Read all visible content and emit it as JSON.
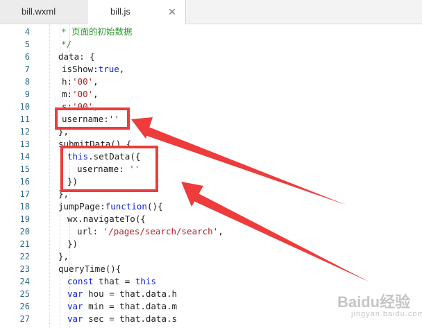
{
  "tabs": [
    {
      "label": "bill.wxml",
      "active": false
    },
    {
      "label": "bill.js",
      "active": true,
      "close_glyph": "✕"
    }
  ],
  "line_numbers": [
    "4",
    "5",
    "6",
    "7",
    "8",
    "9",
    "10",
    "11",
    "12",
    "13",
    "14",
    "15",
    "16",
    "17",
    "18",
    "19",
    "20",
    "21",
    "22",
    "23",
    "24",
    "25",
    "26",
    "27"
  ],
  "code": {
    "l4": "* 页面的初始数据",
    "l5": "*/",
    "l6": "data: {",
    "l7a": "isShow:",
    "l7b": "true",
    "l7c": ",",
    "l8a": "h:",
    "l8b": "'00'",
    "l8c": ",",
    "l9a": "m:",
    "l9b": "'00'",
    "l9c": ",",
    "l10a": "s:",
    "l10b": "'00'",
    "l10c": ",",
    "l11a": "username:",
    "l11b": "''",
    "l12": "},",
    "l13": "submitData() {",
    "l14a": "this",
    "l14b": ".setData({",
    "l15a": "username: ",
    "l15b": "''",
    "l16": "})",
    "l17": "},",
    "l18a": "jumpPage:",
    "l18b": "function",
    "l18c": "(){",
    "l19": "wx.navigateTo({",
    "l20a": "url: ",
    "l20b": "'/pages/search/search'",
    "l20c": ",",
    "l21": "})",
    "l22": "},",
    "l23": "queryTime(){",
    "l24a": "const",
    "l24b": " that = ",
    "l24c": "this",
    "l25a": "var",
    "l25b": " hou = that.data.h",
    "l26a": "var",
    "l26b": " min = that.data.m",
    "l27a": "var",
    "l27b": " sec = that.data.s"
  },
  "watermark": {
    "text": "Baidu经验",
    "sub": "jingyan.baidu.com"
  },
  "colors": {
    "highlight": "#ee3b3b",
    "keyword": "#0a23c9",
    "string": "#a3252a",
    "comment": "#2e9a2e"
  }
}
